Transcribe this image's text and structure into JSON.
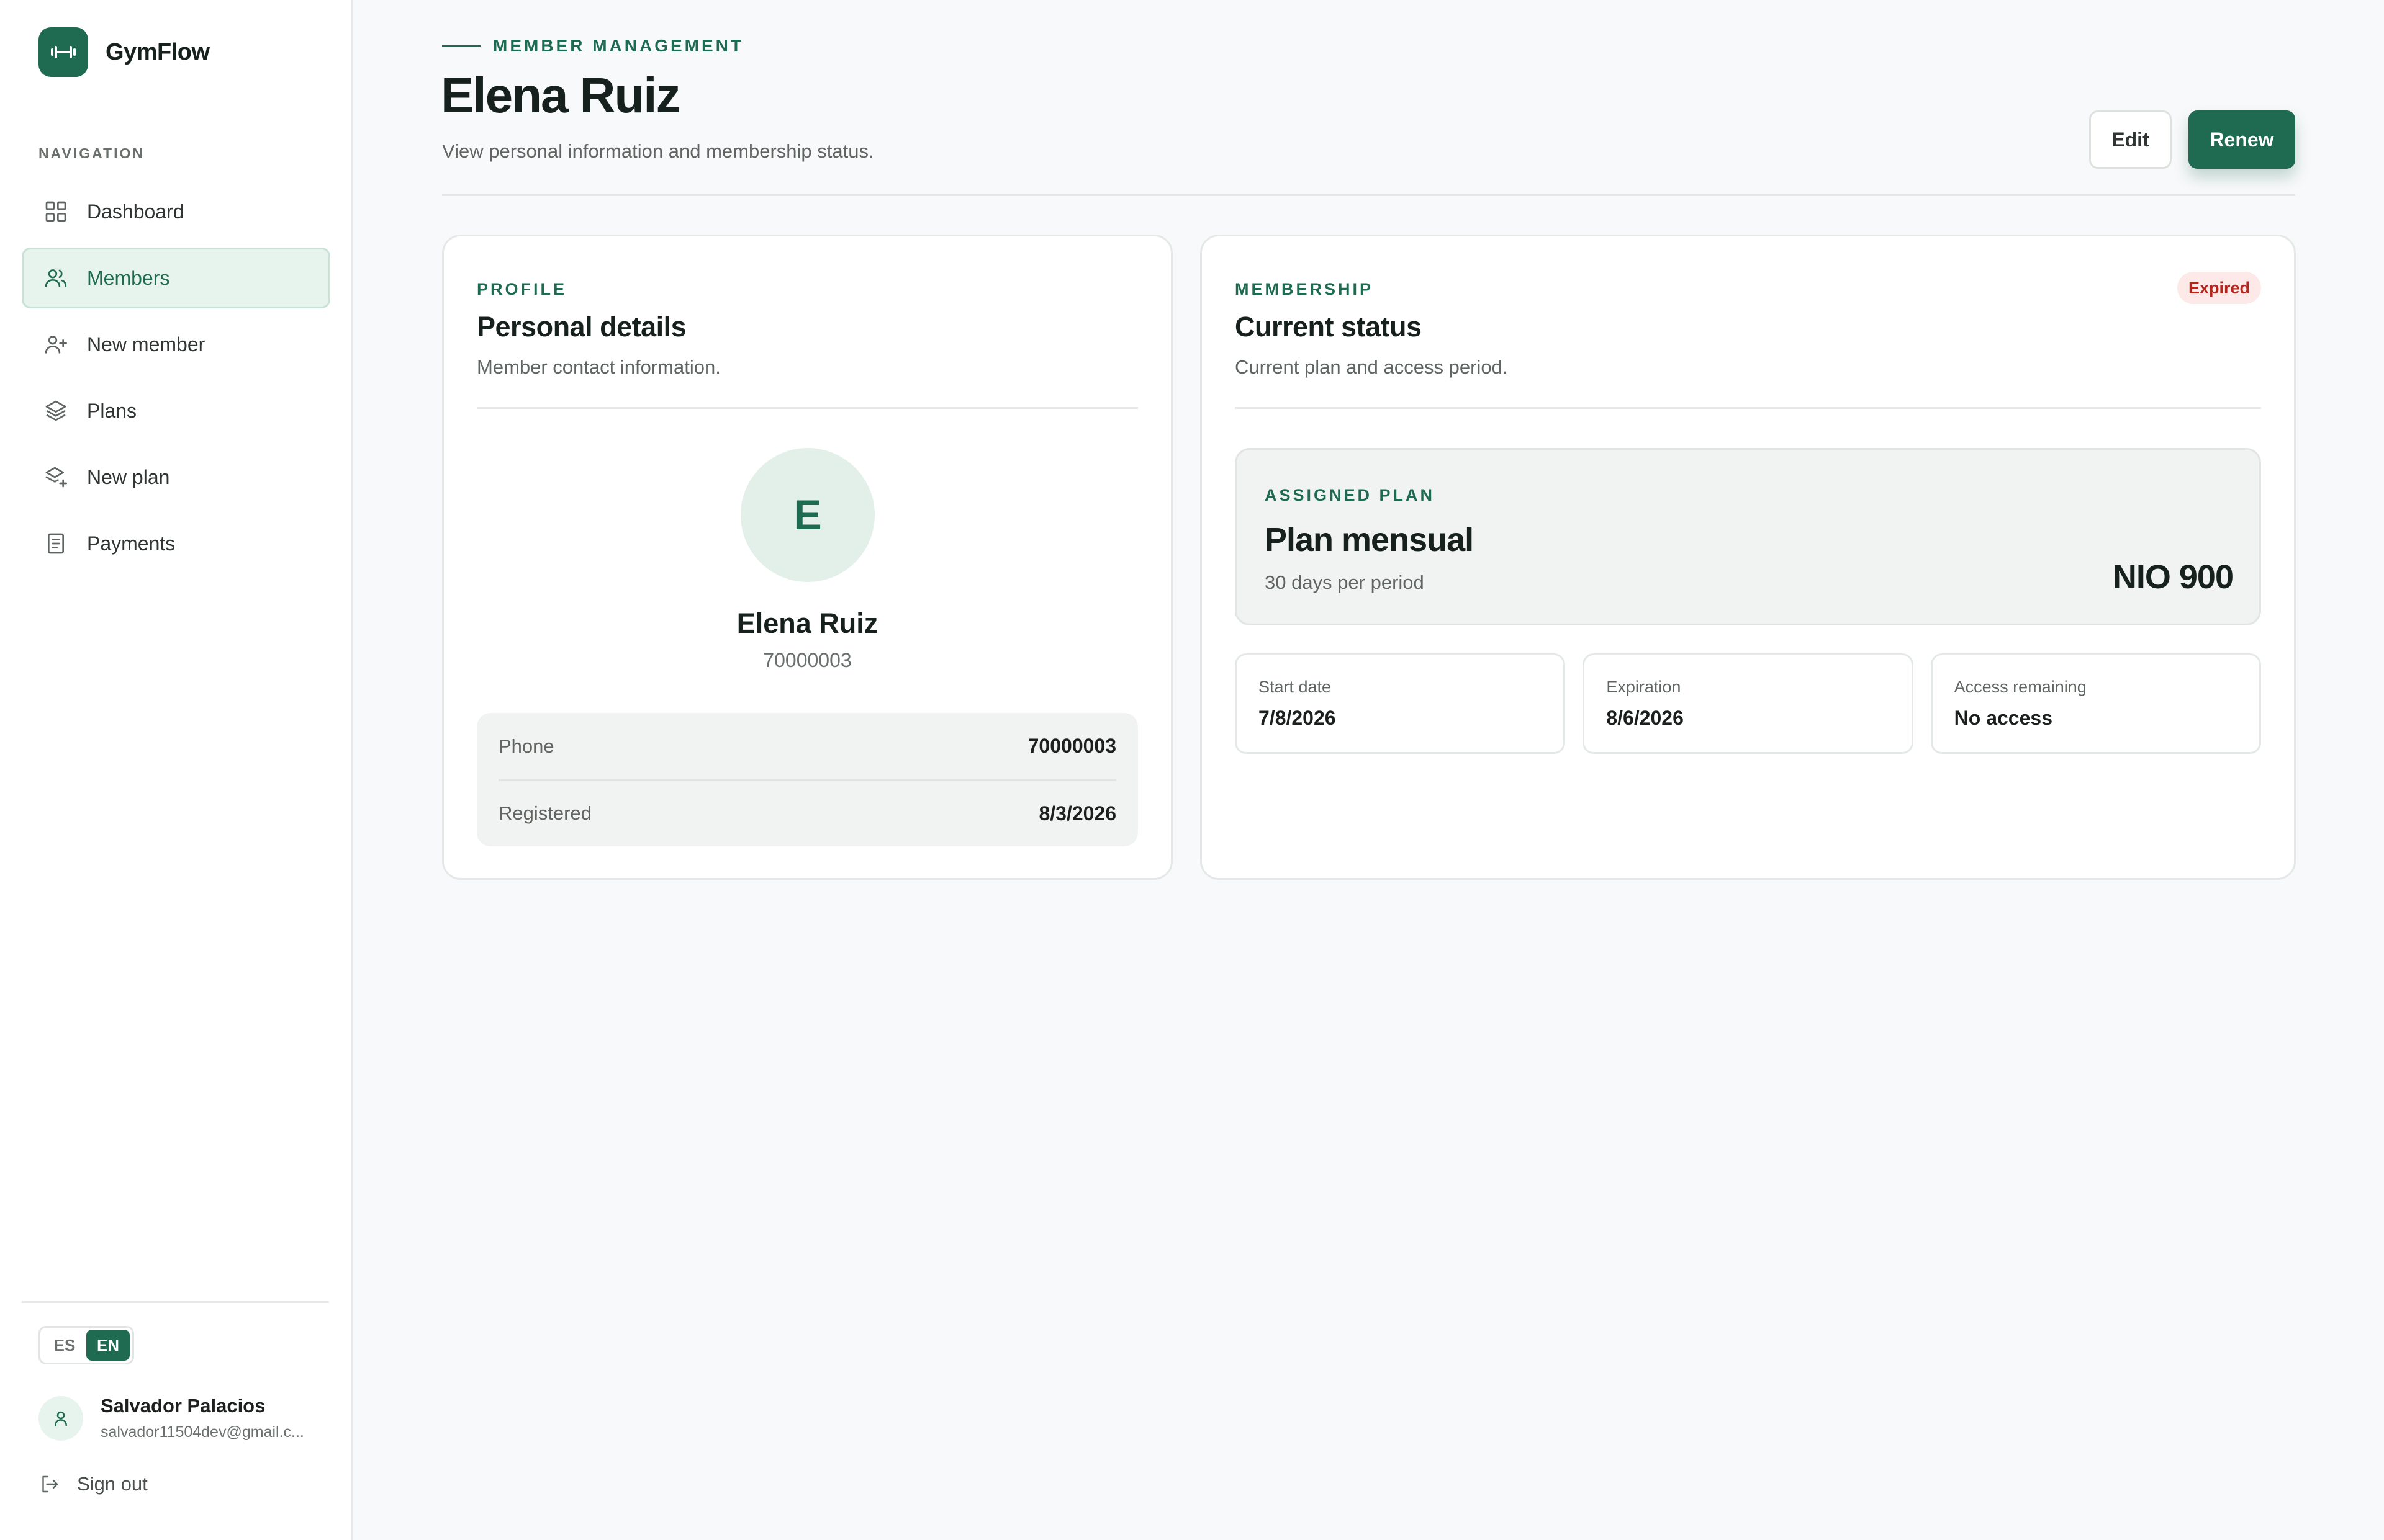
{
  "app": {
    "name": "GymFlow"
  },
  "nav": {
    "heading": "NAVIGATION",
    "items": [
      {
        "label": "Dashboard",
        "icon": "grid-icon",
        "active": false
      },
      {
        "label": "Members",
        "icon": "users-icon",
        "active": true
      },
      {
        "label": "New member",
        "icon": "user-plus-icon",
        "active": false
      },
      {
        "label": "Plans",
        "icon": "layers-icon",
        "active": false
      },
      {
        "label": "New plan",
        "icon": "layers-plus-icon",
        "active": false
      },
      {
        "label": "Payments",
        "icon": "receipt-icon",
        "active": false
      }
    ]
  },
  "language": {
    "options": [
      "ES",
      "EN"
    ],
    "selected": "EN"
  },
  "user": {
    "name": "Salvador Palacios",
    "email": "salvador11504dev@gmail.c..."
  },
  "sign_out": "Sign out",
  "header": {
    "eyebrow": "MEMBER MANAGEMENT",
    "title": "Elena Ruiz",
    "subtitle": "View personal information and membership status.",
    "edit_label": "Edit",
    "renew_label": "Renew"
  },
  "profile": {
    "eyebrow": "PROFILE",
    "title": "Personal details",
    "description": "Member contact information.",
    "avatar_initial": "E",
    "name": "Elena Ruiz",
    "id": "70000003",
    "details": [
      {
        "label": "Phone",
        "value": "70000003"
      },
      {
        "label": "Registered",
        "value": "8/3/2026"
      }
    ]
  },
  "membership": {
    "eyebrow": "MEMBERSHIP",
    "title": "Current status",
    "description": "Current plan and access period.",
    "status": "Expired",
    "plan": {
      "eyebrow": "ASSIGNED PLAN",
      "name": "Plan mensual",
      "period": "30 days per period",
      "price": "NIO 900"
    },
    "stats": [
      {
        "label": "Start date",
        "value": "7/8/2026"
      },
      {
        "label": "Expiration",
        "value": "8/6/2026"
      },
      {
        "label": "Access remaining",
        "value": "No access"
      }
    ]
  },
  "colors": {
    "accent": "#1e6b52",
    "expired_text": "#b3261e",
    "expired_bg": "#fde9e8"
  }
}
